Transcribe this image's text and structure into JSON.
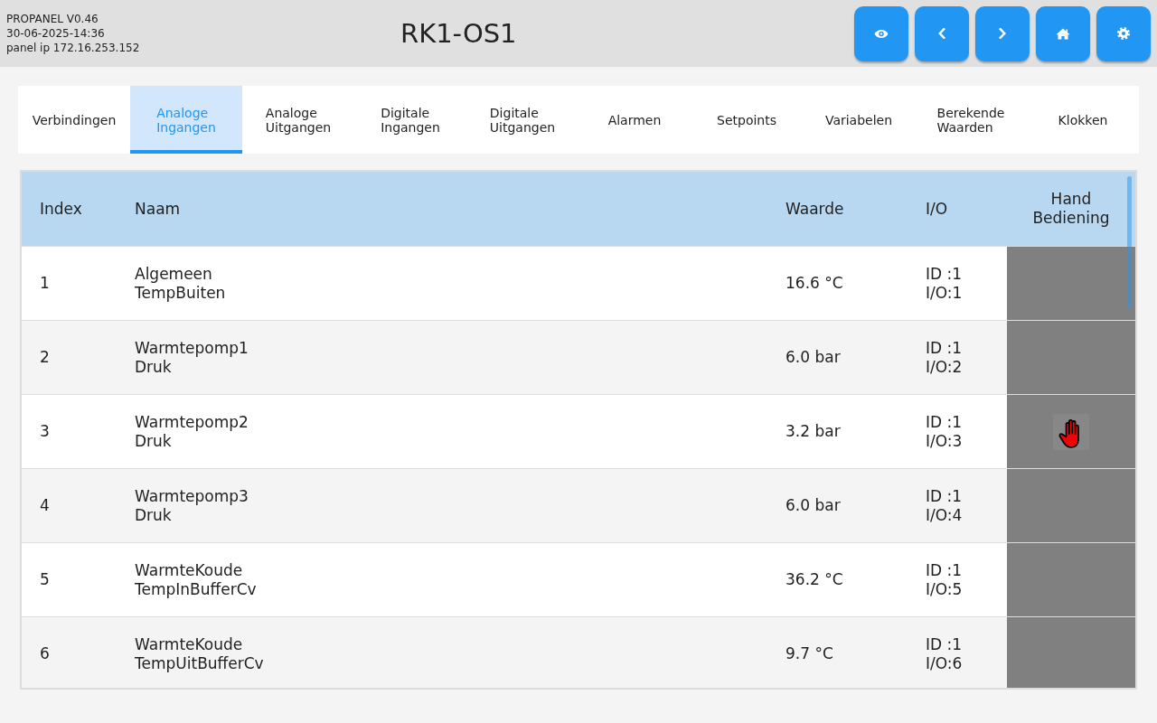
{
  "header": {
    "version": "PROPANEL V0.46",
    "datetime": "30-06-2025-14:36",
    "panel_ip": "panel ip 172.16.253.152",
    "title": "RK1-OS1",
    "buttons": [
      {
        "kind": "view"
      },
      {
        "kind": "back"
      },
      {
        "kind": "forward"
      },
      {
        "kind": "home"
      },
      {
        "kind": "settings"
      }
    ]
  },
  "tabs": [
    {
      "label": "Verbindingen",
      "selected": false
    },
    {
      "label": "Analoge Ingangen",
      "selected": true
    },
    {
      "label": "Analoge Uitgangen",
      "selected": false
    },
    {
      "label": "Digitale Ingangen",
      "selected": false
    },
    {
      "label": "Digitale Uitgangen",
      "selected": false
    },
    {
      "label": "Alarmen",
      "selected": false
    },
    {
      "label": "Setpoints",
      "selected": false
    },
    {
      "label": "Variabelen",
      "selected": false
    },
    {
      "label": "Berekende Waarden",
      "selected": false
    },
    {
      "label": "Klokken",
      "selected": false
    }
  ],
  "table": {
    "columns": [
      "Index",
      "Naam",
      "Waarde",
      "I/O",
      "Hand Bediening"
    ],
    "rows": [
      {
        "index": "1",
        "naam": "Algemeen\nTempBuiten",
        "waarde": "16.6 °C",
        "io": "ID :1\nI/O:1",
        "hand_operated": false
      },
      {
        "index": "2",
        "naam": "Warmtepomp1\nDruk",
        "waarde": "6.0 bar",
        "io": "ID :1\nI/O:2",
        "hand_operated": false
      },
      {
        "index": "3",
        "naam": "Warmtepomp2\nDruk",
        "waarde": "3.2 bar",
        "io": "ID :1\nI/O:3",
        "hand_operated": true
      },
      {
        "index": "4",
        "naam": "Warmtepomp3\nDruk",
        "waarde": "6.0 bar",
        "io": "ID :1\nI/O:4",
        "hand_operated": false
      },
      {
        "index": "5",
        "naam": "WarmteKoude\nTempInBufferCv",
        "waarde": "36.2 °C",
        "io": "ID :1\nI/O:5",
        "hand_operated": false
      },
      {
        "index": "6",
        "naam": "WarmteKoude\nTempUitBufferCv",
        "waarde": "9.7 °C",
        "io": "ID :1\nI/O:6",
        "hand_operated": false
      }
    ]
  }
}
